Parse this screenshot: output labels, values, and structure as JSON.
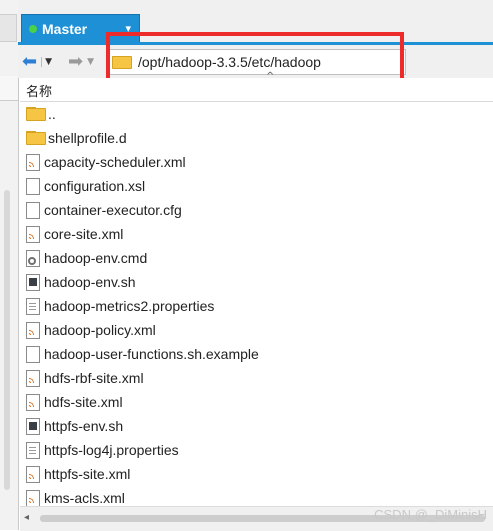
{
  "tab": {
    "label": "Master",
    "status_color": "#49d14a"
  },
  "toolbar": {
    "back_icon": "arrow-left-icon",
    "forward_icon": "arrow-right-icon",
    "path": "/opt/hadoop-3.3.5/etc/hadoop"
  },
  "list": {
    "column_name": "名称",
    "items": [
      {
        "name": "..",
        "type": "parent-folder"
      },
      {
        "name": "shellprofile.d",
        "type": "folder"
      },
      {
        "name": "capacity-scheduler.xml",
        "type": "xml"
      },
      {
        "name": "configuration.xsl",
        "type": "file"
      },
      {
        "name": "container-executor.cfg",
        "type": "file"
      },
      {
        "name": "core-site.xml",
        "type": "xml"
      },
      {
        "name": "hadoop-env.cmd",
        "type": "cmd"
      },
      {
        "name": "hadoop-env.sh",
        "type": "sh"
      },
      {
        "name": "hadoop-metrics2.properties",
        "type": "properties"
      },
      {
        "name": "hadoop-policy.xml",
        "type": "xml"
      },
      {
        "name": "hadoop-user-functions.sh.example",
        "type": "file"
      },
      {
        "name": "hdfs-rbf-site.xml",
        "type": "xml"
      },
      {
        "name": "hdfs-site.xml",
        "type": "xml"
      },
      {
        "name": "httpfs-env.sh",
        "type": "sh"
      },
      {
        "name": "httpfs-log4j.properties",
        "type": "properties"
      },
      {
        "name": "httpfs-site.xml",
        "type": "xml"
      },
      {
        "name": "kms-acls.xml",
        "type": "xml"
      }
    ]
  },
  "watermark": "CSDN @_DiMinisH"
}
